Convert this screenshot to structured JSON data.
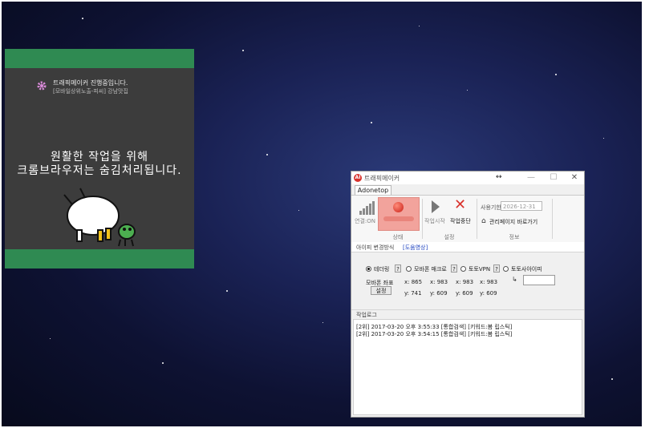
{
  "overlay": {
    "title": "트래픽메이커 진행중입니다.",
    "subtitle": "[모바일상위노출-피씨] 강남맛집",
    "message_line1": "원활한 작업을 위해",
    "message_line2": "크롬브라우저는 숨김처리됩니다."
  },
  "window": {
    "title": "트래픽메이커",
    "app_icon_text": "AI",
    "resize_glyph": "↔",
    "minimize": "—",
    "maximize": "☐",
    "close": "✕",
    "tab": "Adonetop"
  },
  "ribbon": {
    "connection_label": "연결:ON",
    "status_group": "상태",
    "start_label": "작업시작",
    "stop_label": "작업중단",
    "settings_group": "설정",
    "period_label": "사용기한",
    "period_value": "2026-12-31",
    "admin_link": "관리페이지 바로가기",
    "info_group": "정보"
  },
  "subtabs": {
    "method": "아이피 변경방식",
    "help_video": "[도움영상]"
  },
  "options": {
    "radios": [
      {
        "label": "테더링",
        "selected": true
      },
      {
        "label": "모바폰 매크로",
        "selected": false
      },
      {
        "label": "토토VPN",
        "selected": false
      },
      {
        "label": "토토사아이피",
        "selected": false
      }
    ],
    "help": "?"
  },
  "coordinates": {
    "label": "모바폰 좌표",
    "set_button": "설정",
    "x_values": [
      "x: 865",
      "x: 983",
      "x: 983",
      "x: 983"
    ],
    "y_values": [
      "y: 741",
      "y: 609",
      "y: 609",
      "y: 609"
    ],
    "arrow_glyph": "↳"
  },
  "log": {
    "header": "작업로그",
    "lines": [
      "[2위] 2017-03-20 오후 3:55:33  [통합검색] [키워드:봄 립스틱]",
      "[2위] 2017-03-20 오후 3:54:15  [통합검색] [키워드:봄 립스틱]"
    ]
  },
  "colors": {
    "overlay_band": "#2f8a52",
    "overlay_bg": "#3c3c3c",
    "status_highlight": "#f2a39c",
    "accent_red": "#d9322c"
  }
}
